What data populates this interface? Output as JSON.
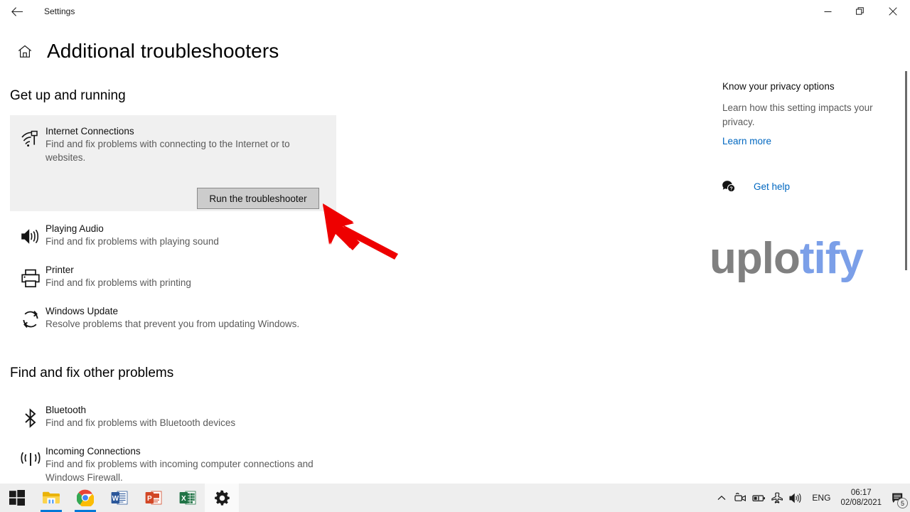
{
  "window": {
    "app_title": "Settings",
    "back_icon": "back-arrow-icon",
    "minimize_icon": "minimize-icon",
    "maximize_icon": "restore-icon",
    "close_icon": "close-icon"
  },
  "page": {
    "home_icon": "home-icon",
    "title": "Additional troubleshooters"
  },
  "sections": [
    {
      "title": "Get up and running",
      "items": [
        {
          "icon": "internet-connections-icon",
          "name": "Internet Connections",
          "desc": "Find and fix problems with connecting to the Internet or to websites.",
          "button": "Run the troubleshooter",
          "selected": true
        },
        {
          "icon": "speaker-icon",
          "name": "Playing Audio",
          "desc": "Find and fix problems with playing sound"
        },
        {
          "icon": "printer-icon",
          "name": "Printer",
          "desc": "Find and fix problems with printing"
        },
        {
          "icon": "sync-icon",
          "name": "Windows Update",
          "desc": "Resolve problems that prevent you from updating Windows."
        }
      ]
    },
    {
      "title": "Find and fix other problems",
      "items": [
        {
          "icon": "bluetooth-icon",
          "name": "Bluetooth",
          "desc": "Find and fix problems with Bluetooth devices"
        },
        {
          "icon": "broadcast-icon",
          "name": "Incoming Connections",
          "desc": "Find and fix problems with incoming computer connections and Windows Firewall."
        }
      ]
    }
  ],
  "right_panel": {
    "title": "Know your privacy options",
    "desc": "Learn how this setting impacts your privacy.",
    "learn_more": "Learn more",
    "get_help_icon": "help-bubble-icon",
    "get_help": "Get help"
  },
  "watermark": {
    "part_a": "uplo",
    "part_b": "tify",
    "color_a": "#808080",
    "color_b": "#7b9fe8"
  },
  "taskbar": {
    "items": [
      {
        "icon": "windows-start-icon",
        "name": "start-button"
      },
      {
        "icon": "file-explorer-icon",
        "name": "file-explorer"
      },
      {
        "icon": "chrome-icon",
        "name": "google-chrome"
      },
      {
        "icon": "word-icon",
        "name": "microsoft-word"
      },
      {
        "icon": "powerpoint-icon",
        "name": "microsoft-powerpoint"
      },
      {
        "icon": "excel-icon",
        "name": "microsoft-excel"
      },
      {
        "icon": "settings-gear-icon",
        "name": "settings"
      }
    ],
    "tray": {
      "chevron": "chevron-up-icon",
      "camera": "camera-icon",
      "battery": "battery-icon",
      "airplane": "airplane-mode-icon",
      "volume": "volume-icon",
      "language": "ENG",
      "time": "06:17",
      "date": "02/08/2021",
      "notification_icon": "action-center-icon",
      "notification_count": "5"
    }
  },
  "colors": {
    "accent_link": "#0067c0",
    "card_background": "#f0f0f0",
    "button_background": "#cccccc",
    "arrow_red": "#ee0000"
  }
}
